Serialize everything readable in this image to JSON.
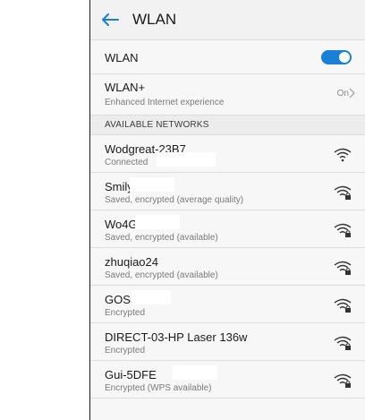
{
  "header": {
    "title": "WLAN"
  },
  "wlan_toggle": {
    "label": "WLAN",
    "state": "on"
  },
  "wlan_plus": {
    "label": "WLAN+",
    "sublabel": "Enhanced Internet experience",
    "value": "On"
  },
  "section_header": "AVAILABLE NETWORKS",
  "networks": [
    {
      "name": "Wodgreat-23B7",
      "status": "Connected"
    },
    {
      "name": "Smily",
      "status": "Saved, encrypted (average quality)"
    },
    {
      "name": "Wo4G",
      "status": "Saved, encrypted (available)"
    },
    {
      "name": "zhuqiao24",
      "status": "Saved, encrypted (available)"
    },
    {
      "name": "GOSS",
      "status": "Encrypted"
    },
    {
      "name": "DIRECT-03-HP Laser 136w",
      "status": "Encrypted"
    },
    {
      "name": "Gui-5DFE",
      "status": "Encrypted (WPS available)"
    }
  ],
  "colors": {
    "accent": "#1a7fd6",
    "connected_text": "#1c6fb8"
  }
}
